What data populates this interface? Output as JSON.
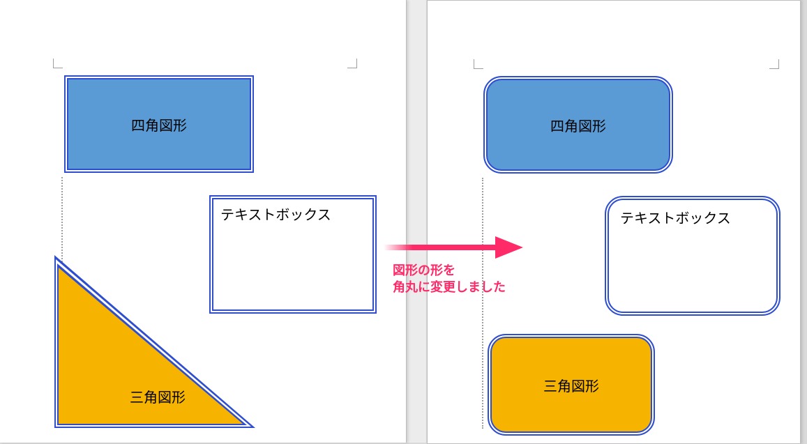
{
  "before": {
    "rect_label": "四角図形",
    "textbox_label": "テキストボックス",
    "triangle_label": "三角図形"
  },
  "after": {
    "rect_label": "四角図形",
    "textbox_label": "テキストボックス",
    "triangle_label": "三角図形"
  },
  "annotation": {
    "line1": "図形の形を",
    "line2": "角丸に変更しました"
  },
  "colors": {
    "shape_border": "#2e4ecf",
    "blue_fill": "#5b9bd5",
    "orange_fill": "#f6b400",
    "annotation": "#ff2a68"
  }
}
